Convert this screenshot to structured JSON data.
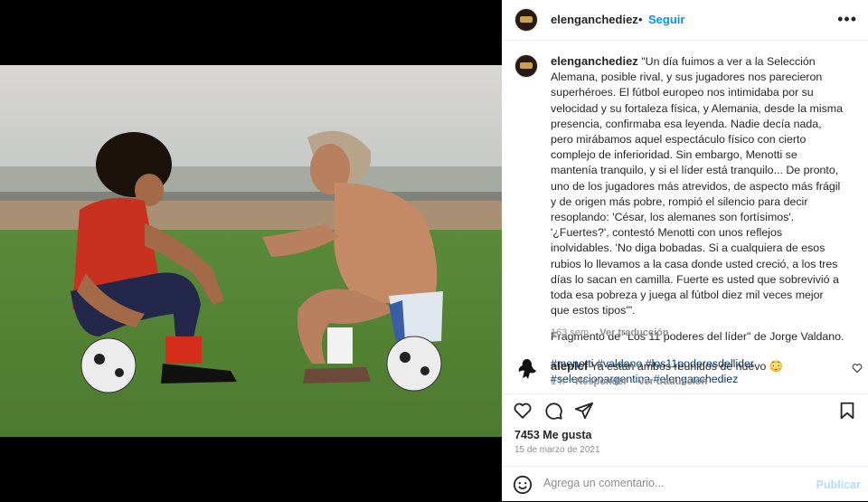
{
  "post": {
    "username": "elenganchediez",
    "follow_label": "Seguir",
    "separator": "•",
    "more_label": "•••"
  },
  "caption": {
    "username": "elenganchediez",
    "text": "\"Un día fuimos a ver a la Selección Alemana, posible rival, y sus jugadores nos parecieron superhéroes. El fútbol europeo nos intimidaba por su velocidad y su fortaleza física, y Alemania, desde la misma presencia, confirmaba esa leyenda. Nadie decía nada, pero mirábamos aquel espectáculo físico con cierto complejo de inferioridad. Sin embargo, Menotti se mantenía tranquilo, y si el líder está tranquilo... De pronto, uno de los jugadores más atrevidos, de aspecto más frágil y de origen más pobre, rompió el silencio para decir resoplando: 'César, los alemanes son fortísimos'. '¿Fuertes?', contestó Menotti con unos reflejos inolvidables. 'No diga bobadas. Si a cualquiera de esos rubios lo llevamos a la casa donde usted creció, a los tres días lo sacan en camilla. Fuerte es usted que sobrevivió a toda esa pobreza y juega al fútbol diez mil veces mejor que estos tipos'\".",
    "source": "Fragmento de \"Los 11 poderes del líder\" de Jorge Valdano.",
    "hashtags": "#menotti #valdano #los11poderesdellider #seleccionargentina #elenganchediez",
    "age": "163 sem",
    "translate_label": "Ver traducción"
  },
  "comment": {
    "username": "aleplcf",
    "text": "Ya están ambos reunidos de nuevo 😳",
    "age": "1 h",
    "reply_label": "Responder",
    "translate_label": "Ver traducción"
  },
  "stats": {
    "likes": "7453 Me gusta",
    "date": "15 de marzo de 2021"
  },
  "composer": {
    "placeholder": "Agrega un comentario...",
    "publish_label": "Publicar"
  },
  "colors": {
    "accent": "#0095f6",
    "hashtag": "#00376b",
    "muted": "#8e8e8e"
  }
}
